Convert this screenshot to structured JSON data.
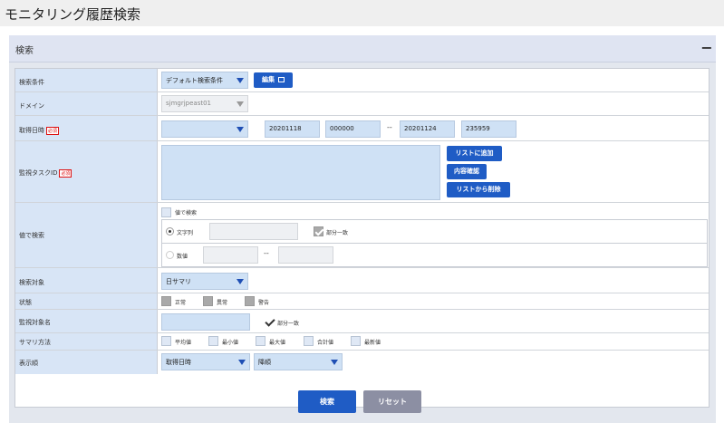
{
  "page": {
    "title": "モニタリング履歴検索"
  },
  "panel": {
    "title": "検索",
    "collapse_label": "−"
  },
  "form": {
    "search_condition": {
      "label": "検索条件",
      "value": "デフォルト検索条件",
      "edit_label": "編集"
    },
    "domain": {
      "label": "ドメイン",
      "value": "sjmgrjpeast01"
    },
    "acquired_time": {
      "label": "取得日時",
      "required": "必須",
      "select_value": "",
      "from_date": "20201118",
      "from_time": "000000",
      "separator": "--",
      "to_date": "20201124",
      "to_time": "235959"
    },
    "task_id": {
      "label": "監視タスクID",
      "required": "必須",
      "value": "",
      "add_label": "リストに追加",
      "confirm_label": "内容確認",
      "remove_label": "リストから削除"
    },
    "value_search": {
      "label": "値で検索",
      "enable_label": "値で検索",
      "string_label": "文字列",
      "string_value": "",
      "partial_label": "部分一致",
      "number_label": "数値",
      "number_from": "",
      "separator": "--",
      "number_to": ""
    },
    "search_target": {
      "label": "検索対象",
      "value": "日サマリ"
    },
    "status": {
      "label": "状態",
      "options": [
        "正常",
        "異常",
        "警告"
      ]
    },
    "monitor_name": {
      "label": "監視対象名",
      "value": "",
      "partial_label": "部分一致"
    },
    "summary_method": {
      "label": "サマリ方法",
      "options": [
        "平均値",
        "最小値",
        "最大値",
        "合計値",
        "最新値"
      ]
    },
    "display_order": {
      "label": "表示順",
      "field_value": "取得日時",
      "order_value": "降順"
    }
  },
  "actions": {
    "search_label": "検索",
    "reset_label": "リセット"
  },
  "colors": {
    "accent": "#1f5cc5",
    "label_bg": "#d8e5f6",
    "input_bg": "#cfe1f5",
    "reset": "#8c8fa3"
  }
}
